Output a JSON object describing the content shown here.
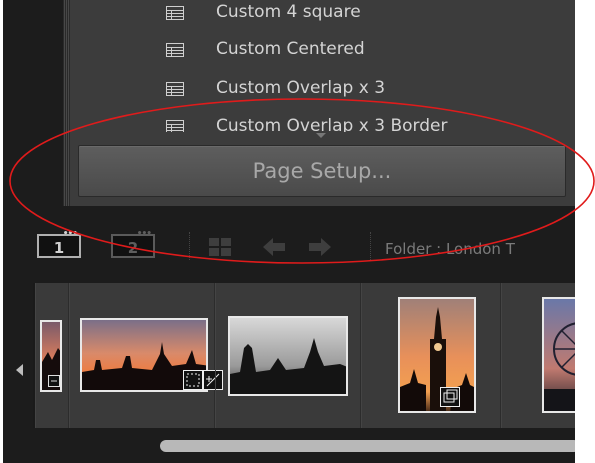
{
  "template_panel": {
    "items": [
      {
        "label": "Custom 4 square",
        "icon": "template-icon"
      },
      {
        "label": "Custom Centered",
        "icon": "template-icon"
      },
      {
        "label": "Custom Overlap x 3",
        "icon": "template-icon"
      },
      {
        "label": "Custom Overlap x 3 Border",
        "icon": "template-icon"
      }
    ],
    "page_setup_label": "Page Setup..."
  },
  "toolbar": {
    "primary_window_label": "1",
    "secondary_window_label": "2",
    "folder_text": "Folder : London T",
    "icons": [
      "grid-icon",
      "arrow-left-icon",
      "arrow-right-icon"
    ]
  },
  "filmstrip": {
    "thumbnails": [
      {
        "subject": "silhouette-sunset",
        "badge": "develop-badge-icon"
      },
      {
        "subject": "parliament-sunset",
        "badge": "crop-adjust-badge-icon"
      },
      {
        "subject": "parliament-monochrome",
        "badge": ""
      },
      {
        "subject": "big-ben-sunset",
        "badge": "stack-badge-icon"
      },
      {
        "subject": "eye-night",
        "badge": ""
      }
    ]
  },
  "annotation": {
    "color": "#e01b1b",
    "shape": "ellipse"
  }
}
